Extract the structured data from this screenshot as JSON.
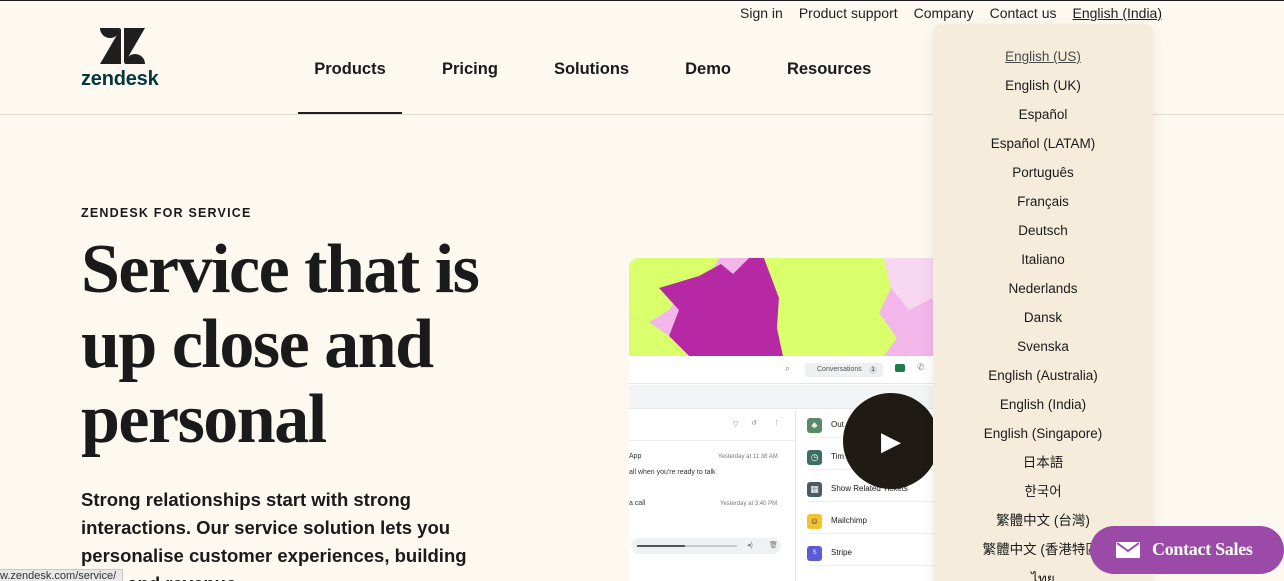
{
  "utility_nav": {
    "sign_in": "Sign in",
    "product_support": "Product support",
    "company": "Company",
    "contact_us": "Contact us",
    "language": "English (India)"
  },
  "logo": {
    "text": "zendesk",
    "icon": "zendesk-logo-icon"
  },
  "main_nav": {
    "items": [
      {
        "label": "Products",
        "active": true
      },
      {
        "label": "Pricing"
      },
      {
        "label": "Solutions"
      },
      {
        "label": "Demo"
      },
      {
        "label": "Resources"
      }
    ]
  },
  "hero": {
    "eyebrow": "ZENDESK FOR SERVICE",
    "title": "Service that is up close and personal",
    "body": "Strong relationships start with strong interactions. Our service solution lets you personalise customer experiences, building trust and revenue."
  },
  "status_bar": {
    "text": "w.zendesk.com/service/"
  },
  "product_mock": {
    "conversations_label": "Conversations",
    "conversations_count": "1",
    "messages": [
      {
        "text": "App",
        "time": "Yesterday at 11:38 AM"
      },
      {
        "text": "all when you're ready to talk",
        "time": ""
      },
      {
        "text": "a call",
        "time": "Yesterday at 3:40 PM"
      }
    ],
    "apps": [
      {
        "label": "Out",
        "icon": "palm-tree-icon",
        "color": "#5a8a6a"
      },
      {
        "label": "Tim",
        "icon": "timer-icon",
        "color": "#3c6e62"
      },
      {
        "label": "Show Related Tickets",
        "icon": "grid-icon",
        "color": "#4c5a66"
      },
      {
        "label": "Mailchimp",
        "icon": "mailchimp-icon",
        "color": "#f2c230"
      },
      {
        "label": "Stripe",
        "icon": "stripe-icon",
        "color": "#5b5bd6"
      }
    ],
    "play_icon": "play-icon"
  },
  "language_menu": {
    "items": [
      "English (US)",
      "English (UK)",
      "Español",
      "Español (LATAM)",
      "Português",
      "Français",
      "Deutsch",
      "Italiano",
      "Nederlands",
      "Dansk",
      "Svenska",
      "English (Australia)",
      "English (India)",
      "English (Singapore)",
      "日本語",
      "한국어",
      "繁體中文 (台灣)",
      "繁體中文 (香港特區)",
      "ไทย"
    ],
    "selected": "English (US)"
  },
  "contact_sales": {
    "label": "Contact Sales",
    "icon": "mail-icon",
    "color": "#9b4aa8"
  },
  "colors": {
    "background": "#fdf9f1",
    "dropdown": "#f5ecdc",
    "brand": "#03363d"
  }
}
